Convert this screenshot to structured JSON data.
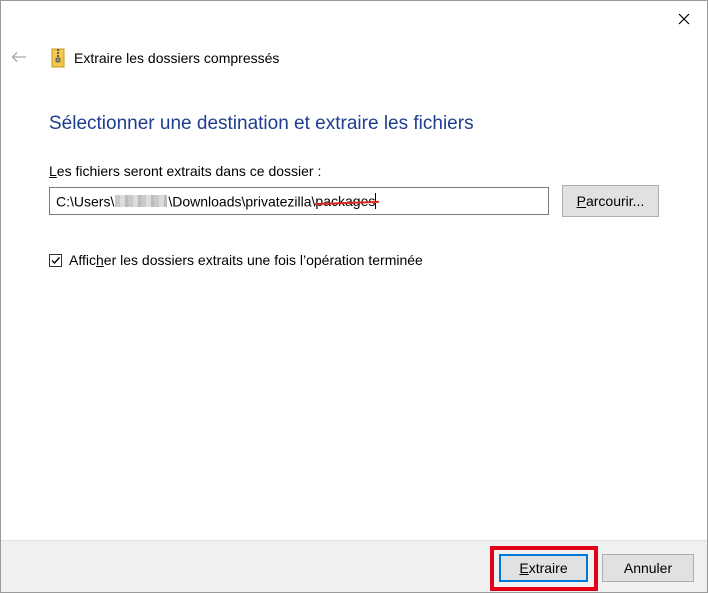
{
  "window": {
    "title": "Extraire les dossiers compressés"
  },
  "page": {
    "heading": "Sélectionner une destination et extraire les fichiers",
    "destination_label_accesskey": "L",
    "destination_label_rest": "es fichiers seront extraits dans ce dossier :",
    "path": {
      "prefix": "C:\\Users\\",
      "suffix": "\\Downloads\\privatezilla\\",
      "struck": "packages"
    },
    "browse_accesskey": "P",
    "browse_rest": "arcourir...",
    "checkbox": {
      "checked": true,
      "label_pre": "Affic",
      "label_accesskey": "h",
      "label_post": "er les dossiers extraits une fois l’opération terminée"
    }
  },
  "footer": {
    "extract_accesskey": "E",
    "extract_rest": "xtraire",
    "cancel_label": "Annuler"
  },
  "colors": {
    "heading": "#1e3d8e",
    "highlight": "#e2001a",
    "focus": "#0078d7"
  },
  "icons": {
    "close": "close-icon",
    "back": "back-arrow-icon",
    "zip": "zip-folder-icon",
    "check": "checkmark-icon"
  }
}
